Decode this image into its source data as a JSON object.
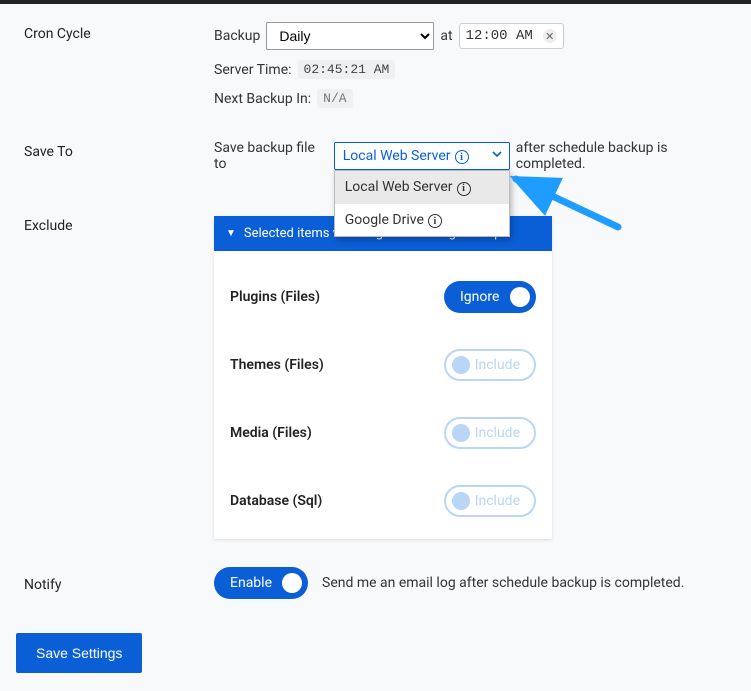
{
  "colors": {
    "accent": "#0a5fd6"
  },
  "cron": {
    "section_label": "Cron Cycle",
    "backup_label": "Backup",
    "frequency": "Daily",
    "at_label": "at",
    "time_display": "12:00  AM",
    "server_time_label": "Server Time:",
    "server_time_value": "02:45:21 AM",
    "next_backup_label": "Next Backup In:",
    "next_backup_value": "N/A"
  },
  "saveto": {
    "section_label": "Save To",
    "prefix": "Save backup file to",
    "selected": "Local Web Server",
    "options": [
      {
        "label": "Local Web Server",
        "has_info": true
      },
      {
        "label": "Google Drive",
        "has_info": true
      }
    ],
    "suffix": "after schedule backup is completed."
  },
  "exclude": {
    "section_label": "Exclude",
    "header": "Selected items will be ignored during backup",
    "items": [
      {
        "name": "Plugins (Files)",
        "enabled": true,
        "on_label": "Ignore",
        "off_label": "Include"
      },
      {
        "name": "Themes (Files)",
        "enabled": false,
        "on_label": "Ignore",
        "off_label": "Include"
      },
      {
        "name": "Media (Files)",
        "enabled": false,
        "on_label": "Ignore",
        "off_label": "Include"
      },
      {
        "name": "Database (Sql)",
        "enabled": false,
        "on_label": "Ignore",
        "off_label": "Include"
      }
    ]
  },
  "notify": {
    "section_label": "Notify",
    "toggle_label": "Enable",
    "desc": "Send me an email log after schedule backup is completed."
  },
  "actions": {
    "save": "Save Settings"
  },
  "_i": "i",
  "_dis": "▼",
  "_x": "✕"
}
